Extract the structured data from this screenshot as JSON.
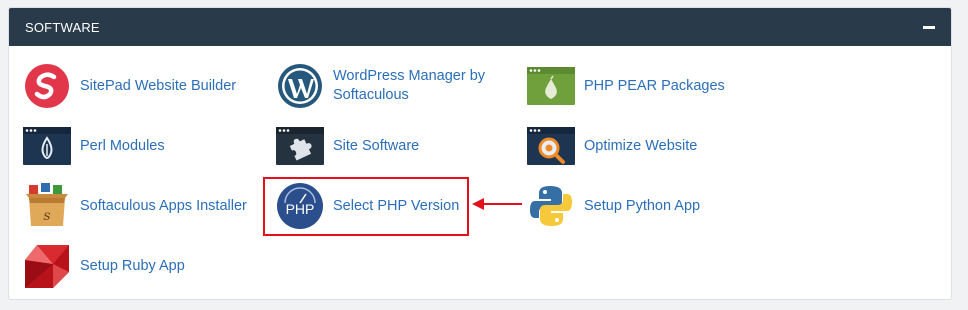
{
  "panel": {
    "title": "SOFTWARE",
    "collapse_icon": "minus-icon"
  },
  "items": [
    {
      "label": "SitePad Website Builder",
      "icon": "sitepad-icon"
    },
    {
      "label": "WordPress Manager by Softaculous",
      "icon": "wordpress-icon"
    },
    {
      "label": "PHP PEAR Packages",
      "icon": "pear-icon"
    },
    {
      "label": "Perl Modules",
      "icon": "perl-icon"
    },
    {
      "label": "Site Software",
      "icon": "puzzle-icon"
    },
    {
      "label": "Optimize Website",
      "icon": "optimize-icon"
    },
    {
      "label": "Softaculous Apps Installer",
      "icon": "softaculous-icon"
    },
    {
      "label": "Select PHP Version",
      "icon": "php-icon"
    },
    {
      "label": "Setup Python App",
      "icon": "python-icon"
    },
    {
      "label": "Setup Ruby App",
      "icon": "ruby-icon"
    }
  ],
  "php_icon_text": "PHP",
  "annotation": {
    "highlight_color": "#e3111b",
    "highlighted_item": "Select PHP Version"
  },
  "colors": {
    "header_bg": "#293a4a",
    "link": "#2b6fb8",
    "accent_red": "#e3111b"
  }
}
